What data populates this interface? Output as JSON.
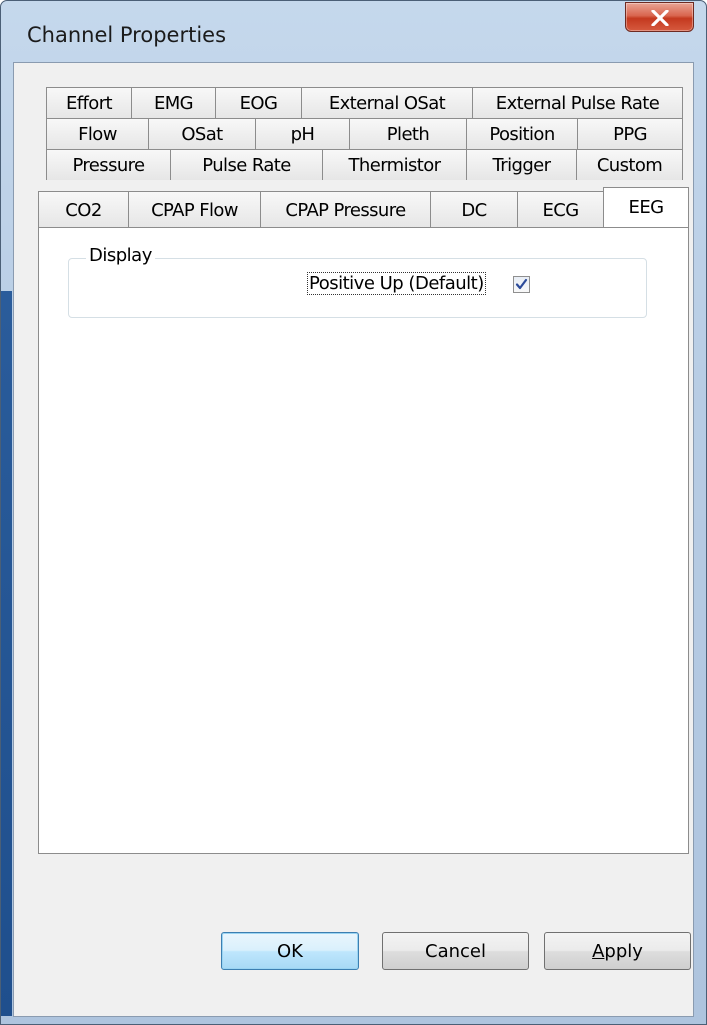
{
  "window": {
    "title": "Channel Properties",
    "close_icon": "close-x-icon"
  },
  "tabs": {
    "row1": [
      "Effort",
      "EMG",
      "EOG",
      "External OSat",
      "External Pulse Rate"
    ],
    "row2": [
      "Flow",
      "OSat",
      "pH",
      "Pleth",
      "Position",
      "PPG"
    ],
    "row3": [
      "Pressure",
      "Pulse Rate",
      "Thermistor",
      "Trigger",
      "Custom"
    ],
    "row4": [
      "CO2",
      "CPAP Flow",
      "CPAP Pressure",
      "DC",
      "ECG",
      "EEG"
    ],
    "active": "EEG"
  },
  "display_group": {
    "label": "Display",
    "checkbox_label": "Positive Up (Default)",
    "checked": true
  },
  "buttons": {
    "ok": "OK",
    "cancel": "Cancel",
    "apply_first": "A",
    "apply_rest": "pply"
  },
  "colors": {
    "frame": "#b7cce4",
    "close_button": "#c4391f",
    "default_button_border": "#3c7fb1",
    "check_mark": "#2c4b9a"
  }
}
